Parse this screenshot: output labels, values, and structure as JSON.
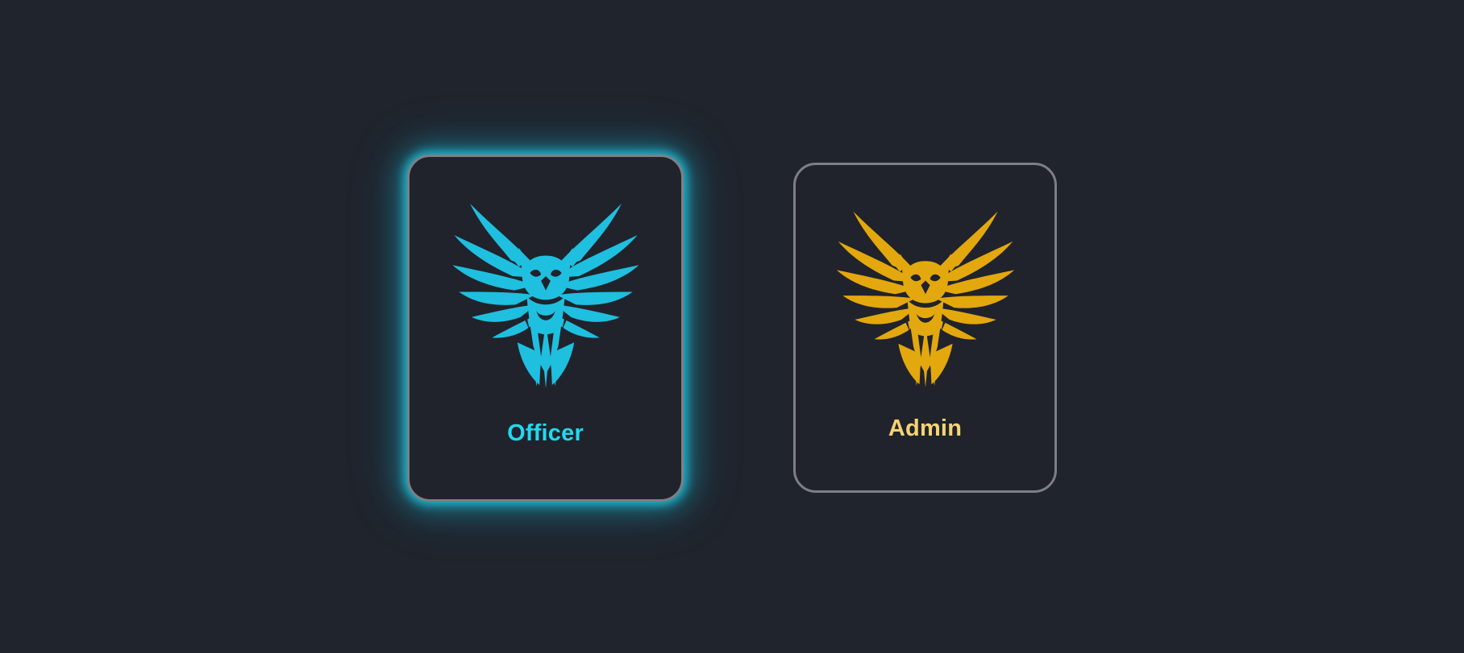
{
  "roles": [
    {
      "id": "officer",
      "label": "Officer",
      "emblem_icon": "owl-emblem-icon",
      "emblem_color": "#1fbfe0",
      "label_color": "#1fdaf0",
      "selected": true,
      "glow_color": "#22c8e2"
    },
    {
      "id": "admin",
      "label": "Admin",
      "emblem_icon": "owl-emblem-icon",
      "emblem_color": "#e3a80d",
      "label_color": "#f5d472",
      "selected": false
    }
  ],
  "theme": {
    "background": "#20242d",
    "card_border": "#7d7f85"
  }
}
